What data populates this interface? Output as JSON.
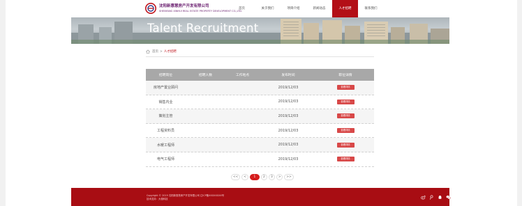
{
  "logo": {
    "name_cn": "沈阳新惠慧房产开发有限公司",
    "name_en": "SHENYANG XINHUI REAL ESTATE PROPERTY DEVELOPMENT CO.,LTD."
  },
  "nav": {
    "items": [
      {
        "label": "首页"
      },
      {
        "label": "关于我们"
      },
      {
        "label": "项目介绍"
      },
      {
        "label": "新闻动态"
      },
      {
        "label": "人才招聘",
        "active": true
      },
      {
        "label": "联系我们"
      }
    ]
  },
  "banner": {
    "title": "Talent Recruitment"
  },
  "breadcrumb": {
    "home": "首页",
    "separator": ">",
    "current": "人才招聘"
  },
  "table": {
    "headers": [
      "招聘岗位",
      "招聘人数",
      "工作地点",
      "发布时间",
      "职位详情"
    ],
    "rows": [
      {
        "position": "房地产置业顾问",
        "count": "",
        "location": "",
        "date": "2019/12/03",
        "action": "查看详情"
      },
      {
        "position": "销售内业",
        "count": "",
        "location": "",
        "date": "2019/12/03",
        "action": "查看详情"
      },
      {
        "position": "策划主管",
        "count": "",
        "location": "",
        "date": "2019/12/03",
        "action": "查看详情"
      },
      {
        "position": "工程资料员",
        "count": "",
        "location": "",
        "date": "2019/12/03",
        "action": "查看详情"
      },
      {
        "position": "水暖工程师",
        "count": "",
        "location": "",
        "date": "2019/12/03",
        "action": "查看详情"
      },
      {
        "position": "电气工程师",
        "count": "",
        "location": "",
        "date": "2019/12/03",
        "action": "查看详情"
      }
    ]
  },
  "pager": {
    "first": "<<",
    "prev": "<",
    "pages": [
      "1",
      "2",
      "3"
    ],
    "current": "1",
    "next": ">",
    "last": ">>"
  },
  "footer": {
    "copyright": "Copyright © 2019 沈阳新惠慧房产开发有限公司 辽ICP备XXXXXXXX号",
    "support": "技术支持：大德科技"
  },
  "colors": {
    "brand_red": "#b30f17",
    "footer_red": "#a80d13",
    "table_header": "#a8a8a8",
    "detail_button": "#d84848"
  }
}
